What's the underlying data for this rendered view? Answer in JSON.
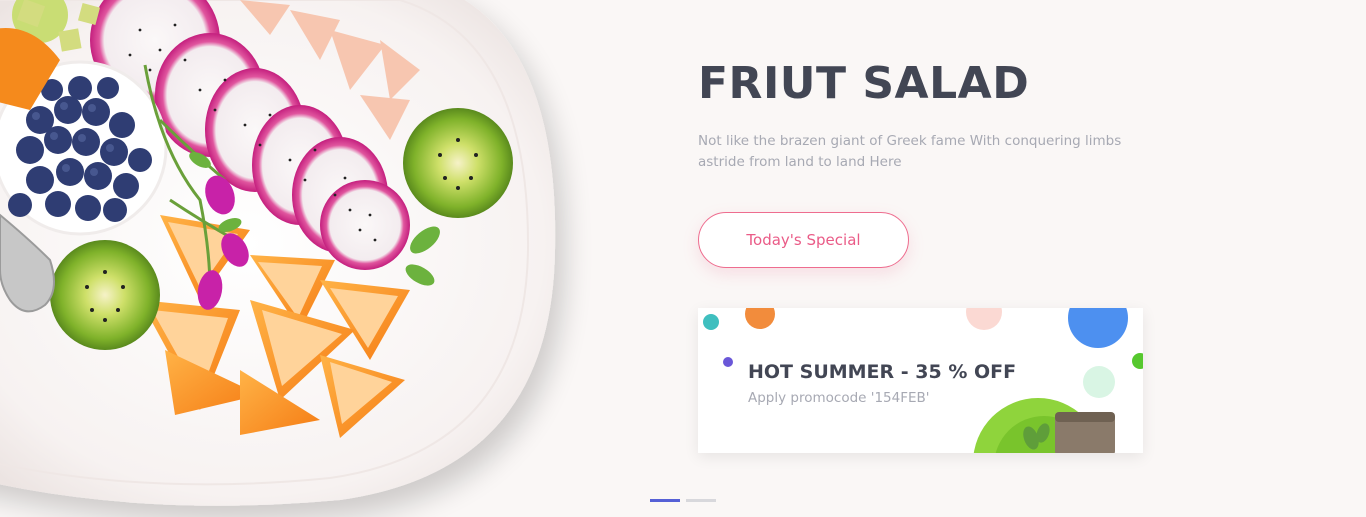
{
  "hero": {
    "title": "FRIUT SALAD",
    "description": "Not like the brazen giant of Greek fame With conquering limbs astride from land to land Here",
    "cta_label": "Today's Special",
    "image_icon": "fruit-salad-plate-image"
  },
  "promo": {
    "title": "HOT SUMMER - 35 % OFF",
    "subtitle": "Apply promocode '154FEB'"
  },
  "carousel": {
    "slides": [
      {
        "label": "",
        "active": true
      },
      {
        "label": "",
        "active": false
      }
    ]
  },
  "colors": {
    "title": "#424654",
    "muted": "#a7a9b3",
    "accent_pink": "#ea5b87",
    "pager_active": "#5560d6",
    "background": "#faf7f6"
  }
}
